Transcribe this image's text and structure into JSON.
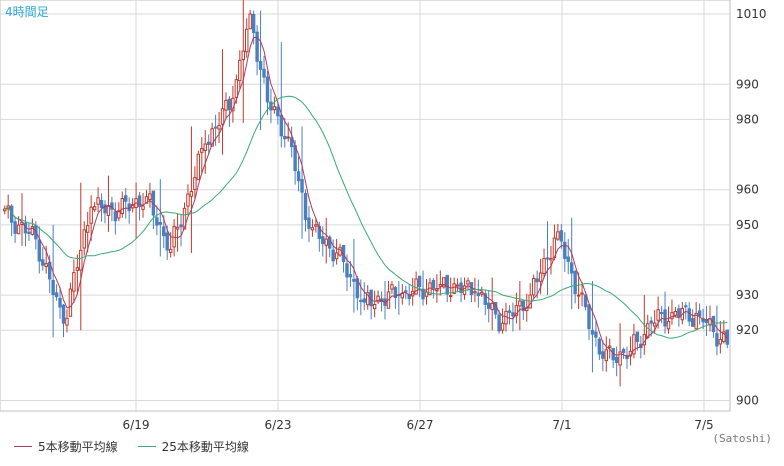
{
  "chart_data": {
    "type": "candlestick",
    "timeframe_label": "4時間足",
    "x_tick_labels": [
      "6/19",
      "6/23",
      "6/27",
      "7/1",
      "7/5"
    ],
    "y_tick_labels": [
      1010,
      990,
      980,
      960,
      950,
      930,
      920,
      900
    ],
    "ylim": [
      897,
      1014
    ],
    "grid": true,
    "legend_position": "bottom-left",
    "series": [
      {
        "name": "5本移動平均線",
        "color": "#b03a5b"
      },
      {
        "name": "25本移動平均線",
        "color": "#3aaa76"
      }
    ],
    "source": "(Satoshi)",
    "colors": {
      "up": "#c0392b",
      "down": "#4a7fc0",
      "grid": "#d9d9d9"
    },
    "segments": [
      {
        "bars": 10,
        "start": 954,
        "end": 946,
        "lo": 943,
        "hi": 959
      },
      {
        "bars": 8,
        "start": 946,
        "end": 922,
        "lo": 917,
        "hi": 950
      },
      {
        "bars": 8,
        "start": 922,
        "end": 955,
        "lo": 919,
        "hi": 962
      },
      {
        "bars": 8,
        "start": 955,
        "end": 954,
        "lo": 947,
        "hi": 964
      },
      {
        "bars": 8,
        "start": 954,
        "end": 958,
        "lo": 945,
        "hi": 962
      },
      {
        "bars": 7,
        "start": 958,
        "end": 943,
        "lo": 940,
        "hi": 963
      },
      {
        "bars": 10,
        "start": 943,
        "end": 973,
        "lo": 941,
        "hi": 978
      },
      {
        "bars": 8,
        "start": 973,
        "end": 986,
        "lo": 969,
        "hi": 1000
      },
      {
        "bars": 5,
        "start": 986,
        "end": 1010,
        "lo": 978,
        "hi": 1014
      },
      {
        "bars": 5,
        "start": 1010,
        "end": 985,
        "lo": 976,
        "hi": 1011
      },
      {
        "bars": 6,
        "start": 985,
        "end": 975,
        "lo": 972,
        "hi": 1002
      },
      {
        "bars": 6,
        "start": 975,
        "end": 949,
        "lo": 945,
        "hi": 978
      },
      {
        "bars": 8,
        "start": 949,
        "end": 942,
        "lo": 938,
        "hi": 952
      },
      {
        "bars": 8,
        "start": 942,
        "end": 928,
        "lo": 924,
        "hi": 946
      },
      {
        "bars": 10,
        "start": 928,
        "end": 930,
        "lo": 923,
        "hi": 934
      },
      {
        "bars": 12,
        "start": 930,
        "end": 933,
        "lo": 927,
        "hi": 937
      },
      {
        "bars": 10,
        "start": 933,
        "end": 931,
        "lo": 928,
        "hi": 935
      },
      {
        "bars": 8,
        "start": 931,
        "end": 922,
        "lo": 919,
        "hi": 935
      },
      {
        "bars": 8,
        "start": 922,
        "end": 930,
        "lo": 919,
        "hi": 934
      },
      {
        "bars": 8,
        "start": 930,
        "end": 948,
        "lo": 929,
        "hi": 951
      },
      {
        "bars": 6,
        "start": 948,
        "end": 930,
        "lo": 925,
        "hi": 952
      },
      {
        "bars": 7,
        "start": 930,
        "end": 912,
        "lo": 907,
        "hi": 934
      },
      {
        "bars": 8,
        "start": 912,
        "end": 914,
        "lo": 903,
        "hi": 922
      },
      {
        "bars": 6,
        "start": 914,
        "end": 922,
        "lo": 912,
        "hi": 930
      },
      {
        "bars": 6,
        "start": 922,
        "end": 925,
        "lo": 919,
        "hi": 931
      },
      {
        "bars": 8,
        "start": 925,
        "end": 924,
        "lo": 921,
        "hi": 928
      },
      {
        "bars": 8,
        "start": 924,
        "end": 916,
        "lo": 912,
        "hi": 927
      }
    ]
  }
}
